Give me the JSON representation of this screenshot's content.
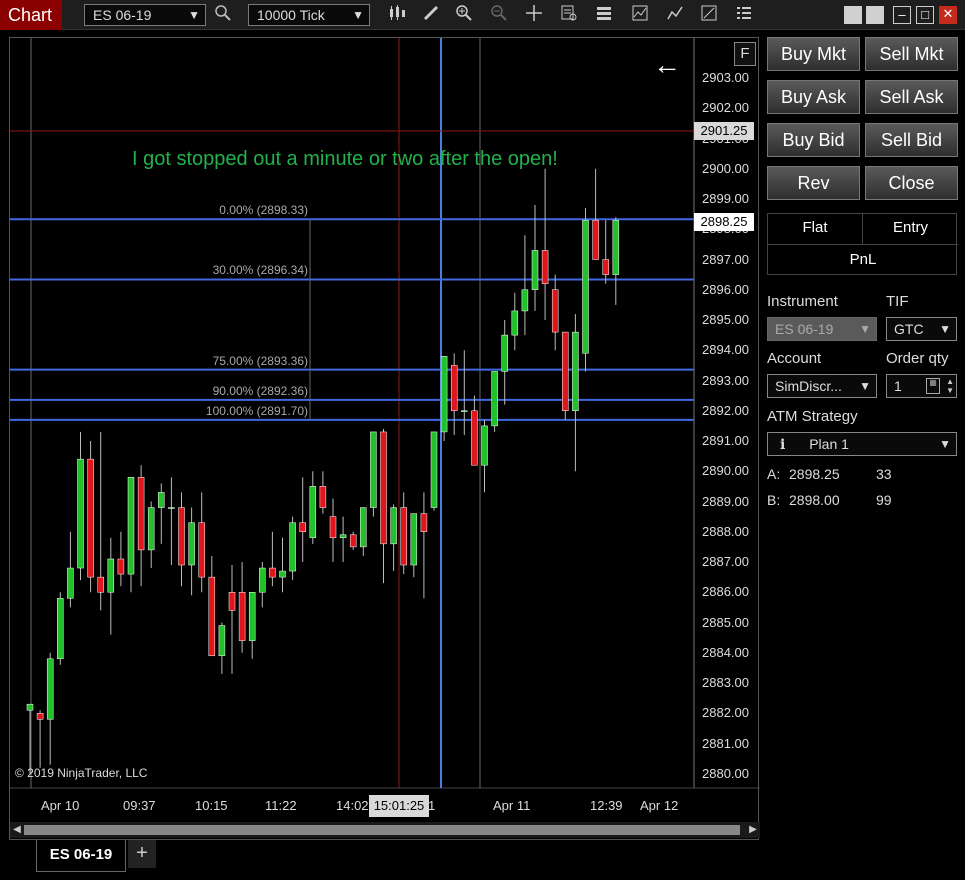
{
  "toolbar": {
    "chart_tab": "Chart",
    "instrument": "ES 06-19",
    "interval": "10000 Tick"
  },
  "chart": {
    "annotation": "I got stopped out a minute or two after the open!",
    "copyright": "© 2019 NinjaTrader, LLC",
    "f_button": "F",
    "y_ticks": [
      "2903.00",
      "2902.00",
      "2901.00",
      "2900.00",
      "2899.00",
      "2898.00",
      "2897.00",
      "2896.00",
      "2895.00",
      "2894.00",
      "2893.00",
      "2892.00",
      "2891.00",
      "2890.00",
      "2889.00",
      "2888.00",
      "2887.00",
      "2886.00",
      "2885.00",
      "2884.00",
      "2883.00",
      "2882.00",
      "2881.00",
      "2880.00"
    ],
    "price_tags": {
      "last": "2901.25",
      "current": "2898.25"
    },
    "fib_levels": [
      {
        "label": "0.00% (2898.33)",
        "price": 2898.33
      },
      {
        "label": "30.00% (2896.34)",
        "price": 2896.34
      },
      {
        "label": "75.00% (2893.36)",
        "price": 2893.36
      },
      {
        "label": "90.00% (2892.36)",
        "price": 2892.36
      },
      {
        "label": "100.00% (2891.70)",
        "price": 2891.7
      }
    ],
    "x_ticks": [
      "Apr 10",
      "09:37",
      "10:15",
      "11:22",
      "14:02",
      "1",
      "Apr 11",
      "12:39",
      "Apr 12"
    ],
    "cursor_time": "15:01:25",
    "horizontal_line_price": 2901.25,
    "colors": {
      "up": "#22c12c",
      "down": "#e0161d",
      "fib": "#4169e1",
      "annotation": "#22b14c",
      "red_line": "#8b1a1a",
      "blue_line": "#4a7fe0"
    }
  },
  "chart_data": {
    "type": "candlestick",
    "candles": [
      {
        "o": 2882.1,
        "h": 2882.3,
        "l": 2880.0,
        "c": 2882.3
      },
      {
        "o": 2882.0,
        "h": 2882.1,
        "l": 2880.2,
        "c": 2881.8
      },
      {
        "o": 2881.8,
        "h": 2884.0,
        "l": 2880.3,
        "c": 2883.8
      },
      {
        "o": 2883.8,
        "h": 2886.0,
        "l": 2883.6,
        "c": 2885.8
      },
      {
        "o": 2885.8,
        "h": 2888.0,
        "l": 2885.5,
        "c": 2886.8
      },
      {
        "o": 2886.8,
        "h": 2891.3,
        "l": 2886.4,
        "c": 2890.4
      },
      {
        "o": 2890.4,
        "h": 2891.0,
        "l": 2886.0,
        "c": 2886.5
      },
      {
        "o": 2886.5,
        "h": 2891.3,
        "l": 2885.4,
        "c": 2886.0
      },
      {
        "o": 2886.0,
        "h": 2887.8,
        "l": 2884.6,
        "c": 2887.1
      },
      {
        "o": 2887.1,
        "h": 2888.0,
        "l": 2886.2,
        "c": 2886.6
      },
      {
        "o": 2886.6,
        "h": 2889.8,
        "l": 2886.0,
        "c": 2889.8
      },
      {
        "o": 2889.8,
        "h": 2890.2,
        "l": 2886.2,
        "c": 2887.4
      },
      {
        "o": 2887.4,
        "h": 2889.0,
        "l": 2886.8,
        "c": 2888.8
      },
      {
        "o": 2888.8,
        "h": 2889.6,
        "l": 2887.6,
        "c": 2889.3
      },
      {
        "o": 2888.8,
        "h": 2889.8,
        "l": 2886.9,
        "c": 2888.8
      },
      {
        "o": 2888.8,
        "h": 2889.3,
        "l": 2886.2,
        "c": 2886.9
      },
      {
        "o": 2886.9,
        "h": 2888.8,
        "l": 2885.9,
        "c": 2888.3
      },
      {
        "o": 2888.3,
        "h": 2889.3,
        "l": 2886.0,
        "c": 2886.5
      },
      {
        "o": 2886.5,
        "h": 2887.2,
        "l": 2883.9,
        "c": 2883.9
      },
      {
        "o": 2883.9,
        "h": 2885.0,
        "l": 2883.3,
        "c": 2884.9
      },
      {
        "o": 2886.0,
        "h": 2886.9,
        "l": 2883.3,
        "c": 2885.4
      },
      {
        "o": 2886.0,
        "h": 2887.0,
        "l": 2884.0,
        "c": 2884.4
      },
      {
        "o": 2884.4,
        "h": 2886.0,
        "l": 2883.8,
        "c": 2886.0
      },
      {
        "o": 2886.0,
        "h": 2887.0,
        "l": 2885.5,
        "c": 2886.8
      },
      {
        "o": 2886.8,
        "h": 2888.0,
        "l": 2886.2,
        "c": 2886.5
      },
      {
        "o": 2886.5,
        "h": 2887.8,
        "l": 2886.0,
        "c": 2886.7
      },
      {
        "o": 2886.7,
        "h": 2888.5,
        "l": 2886.4,
        "c": 2888.3
      },
      {
        "o": 2888.3,
        "h": 2889.8,
        "l": 2887.0,
        "c": 2888.0
      },
      {
        "o": 2887.8,
        "h": 2890.0,
        "l": 2887.6,
        "c": 2889.5
      },
      {
        "o": 2889.5,
        "h": 2890.0,
        "l": 2888.6,
        "c": 2888.8
      },
      {
        "o": 2888.5,
        "h": 2889.1,
        "l": 2887.0,
        "c": 2887.8
      },
      {
        "o": 2887.8,
        "h": 2888.5,
        "l": 2887.0,
        "c": 2887.9
      },
      {
        "o": 2887.9,
        "h": 2888.0,
        "l": 2887.4,
        "c": 2887.5
      },
      {
        "o": 2887.5,
        "h": 2888.5,
        "l": 2887.2,
        "c": 2888.8
      },
      {
        "o": 2888.8,
        "h": 2891.3,
        "l": 2888.5,
        "c": 2891.3
      },
      {
        "o": 2891.3,
        "h": 2891.4,
        "l": 2886.3,
        "c": 2887.6
      },
      {
        "o": 2887.6,
        "h": 2888.9,
        "l": 2886.7,
        "c": 2888.8
      },
      {
        "o": 2888.8,
        "h": 2889.3,
        "l": 2886.6,
        "c": 2886.9
      },
      {
        "o": 2886.9,
        "h": 2888.6,
        "l": 2886.5,
        "c": 2888.6
      },
      {
        "o": 2888.6,
        "h": 2889.3,
        "l": 2885.8,
        "c": 2888.0
      },
      {
        "o": 2888.8,
        "h": 2891.3,
        "l": 2888.7,
        "c": 2891.3
      },
      {
        "o": 2891.3,
        "h": 2893.8,
        "l": 2891.0,
        "c": 2893.8
      },
      {
        "o": 2893.5,
        "h": 2893.9,
        "l": 2891.2,
        "c": 2892.0
      },
      {
        "o": 2892.0,
        "h": 2894.0,
        "l": 2891.2,
        "c": 2892.0
      },
      {
        "o": 2892.0,
        "h": 2892.5,
        "l": 2890.2,
        "c": 2890.2
      },
      {
        "o": 2890.2,
        "h": 2891.7,
        "l": 2889.3,
        "c": 2891.5
      },
      {
        "o": 2891.5,
        "h": 2893.3,
        "l": 2891.3,
        "c": 2893.3
      },
      {
        "o": 2893.3,
        "h": 2895.0,
        "l": 2892.2,
        "c": 2894.5
      },
      {
        "o": 2894.5,
        "h": 2895.9,
        "l": 2894.0,
        "c": 2895.3
      },
      {
        "o": 2895.3,
        "h": 2897.8,
        "l": 2894.5,
        "c": 2896.0
      },
      {
        "o": 2896.0,
        "h": 2898.8,
        "l": 2895.3,
        "c": 2897.3
      },
      {
        "o": 2897.3,
        "h": 2900.0,
        "l": 2895.0,
        "c": 2896.2
      },
      {
        "o": 2896.0,
        "h": 2896.5,
        "l": 2894.0,
        "c": 2894.6
      },
      {
        "o": 2894.6,
        "h": 2894.6,
        "l": 2891.7,
        "c": 2892.0
      },
      {
        "o": 2892.0,
        "h": 2895.2,
        "l": 2890.0,
        "c": 2894.6
      },
      {
        "o": 2893.9,
        "h": 2898.7,
        "l": 2893.3,
        "c": 2898.3
      },
      {
        "o": 2898.3,
        "h": 2900.0,
        "l": 2897.0,
        "c": 2897.0
      },
      {
        "o": 2897.0,
        "h": 2898.3,
        "l": 2896.2,
        "c": 2896.5
      },
      {
        "o": 2896.5,
        "h": 2898.4,
        "l": 2895.5,
        "c": 2898.3
      }
    ]
  },
  "panel": {
    "buttons": [
      "Buy Mkt",
      "Sell Mkt",
      "Buy Ask",
      "Sell Ask",
      "Buy Bid",
      "Sell Bid",
      "Rev",
      "Close"
    ],
    "info": {
      "flat": "Flat",
      "entry": "Entry",
      "pnl": "PnL"
    },
    "instrument_label": "Instrument",
    "instrument_value": "ES 06-19",
    "tif_label": "TIF",
    "tif_value": "GTC",
    "account_label": "Account",
    "account_value": "SimDiscr...",
    "qty_label": "Order qty",
    "qty_value": "1",
    "atm_label": "ATM Strategy",
    "atm_value": "Plan 1",
    "ask_label": "A:",
    "ask_price": "2898.25",
    "ask_size": "33",
    "bid_label": "B:",
    "bid_price": "2898.00",
    "bid_size": "99"
  },
  "bottom": {
    "tab": "ES 06-19",
    "add": "+"
  }
}
